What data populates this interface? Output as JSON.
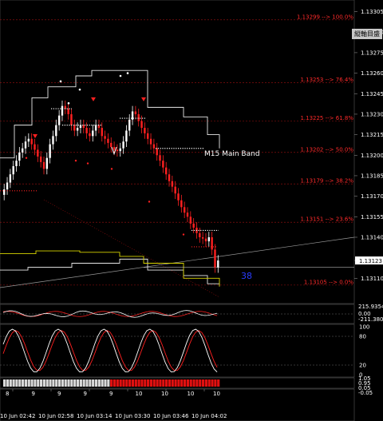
{
  "chart_data": {
    "type": "candlestick",
    "price_axis": {
      "min": 1.131,
      "max": 1.133,
      "ticks": [
        "1.13305",
        "1.13290",
        "1.13275",
        "1.13260",
        "1.13245",
        "1.13230",
        "1.13215",
        "1.13200",
        "1.13185",
        "1.13170",
        "1.13155",
        "1.13140",
        "1.13123",
        "1.13110"
      ],
      "current_price": "1.13123"
    },
    "fib_levels": [
      {
        "label": "1.13299 --> 100.0%",
        "price": 1.13299
      },
      {
        "label": "1.13253 --> 76.4%",
        "price": 1.13253
      },
      {
        "label": "1.13225 --> 61.8%",
        "price": 1.13225
      },
      {
        "label": "1.13202 --> 50.0%",
        "price": 1.13202
      },
      {
        "label": "1.13179 --> 38.2%",
        "price": 1.13179
      },
      {
        "label": "1.13151 --> 23.6%",
        "price": 1.13151
      },
      {
        "label": "1.13105 --> 0.0%",
        "price": 1.13105
      }
    ],
    "band_label": "M15 Main Band",
    "counter_label": "38",
    "oscillator1": {
      "ticks": [
        "215.9354",
        "0.00",
        "-211.3806"
      ]
    },
    "oscillator2": {
      "ticks": [
        "100",
        "80",
        "20",
        "0"
      ]
    },
    "strip_ticks": [
      "1.05",
      "0.95",
      "0.05",
      "-0.05"
    ],
    "day_labels": [
      "8",
      "9",
      "9",
      "9",
      "9",
      "10",
      "10",
      "10",
      "10"
    ],
    "time_labels": [
      "10 Jun 02:42",
      "10 Jun 02:58",
      "10 Jun 03:14",
      "10 Jun 03:30",
      "10 Jun 03:46",
      "10 Jun 04:02"
    ],
    "candles": [
      1.13175,
      1.1318,
      1.13186,
      1.13192,
      1.13196,
      1.13202,
      1.13205,
      1.1321,
      1.13212,
      1.13208,
      1.13204,
      1.13199,
      1.13195,
      1.1319,
      1.13198,
      1.13208,
      1.13214,
      1.13222,
      1.13229,
      1.13236,
      1.13234,
      1.1323,
      1.13222,
      1.13218,
      1.1322,
      1.13222,
      1.1322,
      1.13216,
      1.13214,
      1.13218,
      1.13222,
      1.1322,
      1.13214,
      1.13212,
      1.13209,
      1.13206,
      1.13204,
      1.13203,
      1.13205,
      1.1321,
      1.13218,
      1.13226,
      1.13232,
      1.1323,
      1.13225,
      1.1322,
      1.13216,
      1.13212,
      1.13208,
      1.13205,
      1.132,
      1.13196,
      1.13191,
      1.13186,
      1.13181,
      1.13177,
      1.13172,
      1.13167,
      1.13162,
      1.13158,
      1.13155,
      1.1315,
      1.13147,
      1.13143,
      1.1314,
      1.13139,
      1.13137,
      1.1314,
      1.13131,
      1.13118,
      1.13123
    ]
  },
  "ui": {
    "vertical_axis_button": "縦軸目盛"
  }
}
